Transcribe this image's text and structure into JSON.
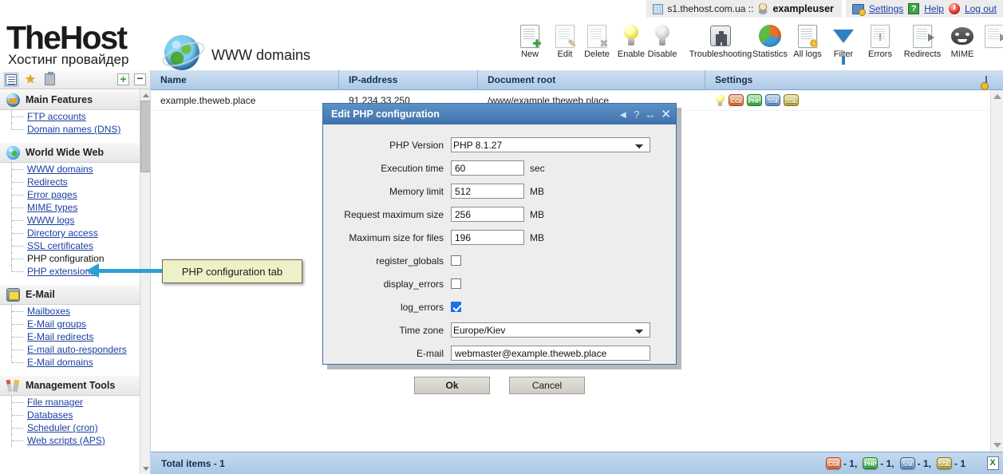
{
  "header": {
    "server": "s1.thehost.com.ua ::",
    "username": "exampleuser",
    "settings": "Settings",
    "help": "Help",
    "logout": "Log out"
  },
  "brand": {
    "name": "TheHost",
    "tagline": "Хостинг провайдер",
    "page_title": "WWW domains"
  },
  "toolbar": {
    "items": [
      {
        "label": "New",
        "icon": "new-document-icon"
      },
      {
        "label": "Edit",
        "icon": "edit-document-icon"
      },
      {
        "label": "Delete",
        "icon": "delete-document-icon"
      },
      {
        "label": "Enable",
        "icon": "lightbulb-on-icon"
      },
      {
        "label": "Disable",
        "icon": "lightbulb-off-icon"
      },
      {
        "label": "Troubleshooting",
        "icon": "first-aid-kit-icon"
      },
      {
        "label": "Statistics",
        "icon": "pie-chart-icon"
      },
      {
        "label": "All logs",
        "icon": "logs-icon"
      },
      {
        "label": "Filter",
        "icon": "funnel-icon"
      },
      {
        "label": "Errors",
        "icon": "error-document-icon"
      },
      {
        "label": "Redirects",
        "icon": "redirect-document-icon"
      },
      {
        "label": "MIME",
        "icon": "mask-icon"
      },
      {
        "label": "",
        "icon": "export-icon"
      }
    ]
  },
  "sidebar": {
    "toolbar_icons": [
      "list-view-icon",
      "favorites-star-icon",
      "clipboard-icon",
      "expand-all-icon",
      "collapse-all-icon"
    ],
    "groups": [
      {
        "title": "Main Features",
        "icon": "main-features-icon",
        "items": [
          {
            "label": "FTP accounts",
            "current": false
          },
          {
            "label": "Domain names (DNS)",
            "current": false
          }
        ]
      },
      {
        "title": "World Wide Web",
        "icon": "world-wide-web-icon",
        "items": [
          {
            "label": "WWW domains",
            "current": false
          },
          {
            "label": "Redirects",
            "current": false
          },
          {
            "label": "Error pages",
            "current": false
          },
          {
            "label": "MIME types",
            "current": false
          },
          {
            "label": "WWW logs",
            "current": false
          },
          {
            "label": "Directory access",
            "current": false
          },
          {
            "label": "SSL certificates",
            "current": false
          },
          {
            "label": "PHP configuration",
            "current": true
          },
          {
            "label": "PHP extensions",
            "current": false
          }
        ]
      },
      {
        "title": "E-Mail",
        "icon": "email-icon",
        "items": [
          {
            "label": "Mailboxes",
            "current": false
          },
          {
            "label": "E-Mail groups",
            "current": false
          },
          {
            "label": "E-Mail redirects",
            "current": false
          },
          {
            "label": "E-mail auto-responders",
            "current": false
          },
          {
            "label": "E-Mail domains",
            "current": false
          }
        ]
      },
      {
        "title": "Management Tools",
        "icon": "management-tools-icon",
        "items": [
          {
            "label": "File manager",
            "current": false
          },
          {
            "label": "Databases",
            "current": false
          },
          {
            "label": "Scheduler (cron)",
            "current": false
          },
          {
            "label": "Web scripts (APS)",
            "current": false
          }
        ]
      }
    ]
  },
  "table": {
    "columns": [
      "Name",
      "IP-address",
      "Document root",
      "Settings"
    ],
    "rows": [
      {
        "name": "example.theweb.place",
        "ip": "91.234.33.250",
        "docroot": "/www/example.theweb.place",
        "settings": [
          "bulb-icon",
          "CGI",
          "PHP",
          "SSI",
          "SSL"
        ]
      }
    ]
  },
  "status": {
    "total": "Total items - 1",
    "counts": [
      {
        "badge": "CGI",
        "text": "- 1,"
      },
      {
        "badge": "PHP",
        "text": "- 1,"
      },
      {
        "badge": "SSI",
        "text": "- 1,"
      },
      {
        "badge": "SSL",
        "text": "- 1"
      }
    ],
    "export_icon": "excel-export-icon"
  },
  "dialog": {
    "title": "Edit PHP configuration",
    "titlebar_icons": [
      "pin-icon",
      "help-icon",
      "resize-icon",
      "close-icon"
    ],
    "fields": {
      "php_version": {
        "label": "PHP Version",
        "value": "PHP 8.1.27"
      },
      "execution_time": {
        "label": "Execution time",
        "value": "60",
        "unit": "sec"
      },
      "memory_limit": {
        "label": "Memory limit",
        "value": "512",
        "unit": "MB"
      },
      "request_max_size": {
        "label": "Request maximum size",
        "value": "256",
        "unit": "MB"
      },
      "max_file_size": {
        "label": "Maximum size for files",
        "value": "196",
        "unit": "MB"
      },
      "register_globals": {
        "label": "register_globals",
        "checked": false
      },
      "display_errors": {
        "label": "display_errors",
        "checked": false
      },
      "log_errors": {
        "label": "log_errors",
        "checked": true
      },
      "time_zone": {
        "label": "Time zone",
        "value": "Europe/Kiev"
      },
      "email": {
        "label": "E-mail",
        "value": "webmaster@example.theweb.place"
      }
    },
    "ok": "Ok",
    "cancel": "Cancel"
  },
  "annotation": {
    "text": "PHP configuration tab"
  },
  "colors": {
    "accent_blue": "#3f72ac",
    "header_blue": "#aec9e6",
    "link_blue": "#1a3fa0",
    "annotation_yellow": "#eef0c8",
    "annotation_arrow": "#2e9fd4",
    "checkbox_on": "#1a73e8"
  }
}
